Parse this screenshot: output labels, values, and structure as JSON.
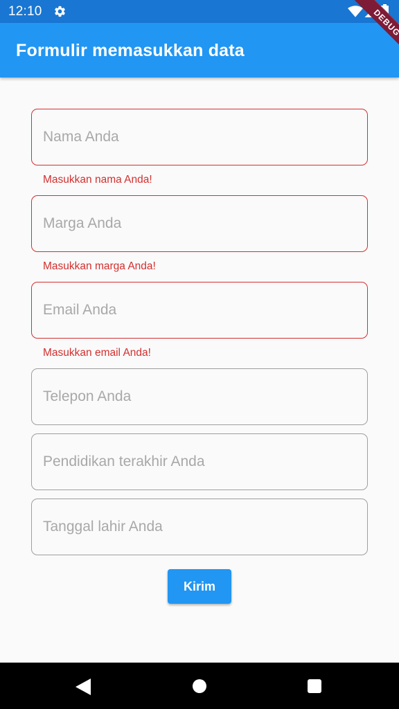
{
  "status_bar": {
    "time": "12:10",
    "icons": [
      "gear-icon",
      "wifi-icon",
      "signal-icon",
      "battery-icon"
    ]
  },
  "app_bar": {
    "title": "Formulir memasukkan data",
    "color": "#2196f3"
  },
  "debug_banner": "DEBUG",
  "form": {
    "fields": [
      {
        "placeholder": "Nama Anda",
        "value": "",
        "error": "Masukkan nama Anda!"
      },
      {
        "placeholder": "Marga Anda",
        "value": "",
        "error": "Masukkan marga Anda!"
      },
      {
        "placeholder": "Email Anda",
        "value": "",
        "error": "Masukkan email Anda!"
      },
      {
        "placeholder": "Telepon Anda",
        "value": ""
      },
      {
        "placeholder": "Pendidikan terakhir Anda",
        "value": ""
      },
      {
        "placeholder": "Tanggal lahir Anda",
        "value": ""
      }
    ],
    "submit_label": "Kirim"
  },
  "colors": {
    "primary": "#2196f3",
    "status_bar": "#1976d2",
    "error": "#d32f2f",
    "border": "#9e9e9e"
  },
  "nav_bar": {
    "icons": [
      "back-icon",
      "home-icon",
      "recents-icon"
    ]
  }
}
